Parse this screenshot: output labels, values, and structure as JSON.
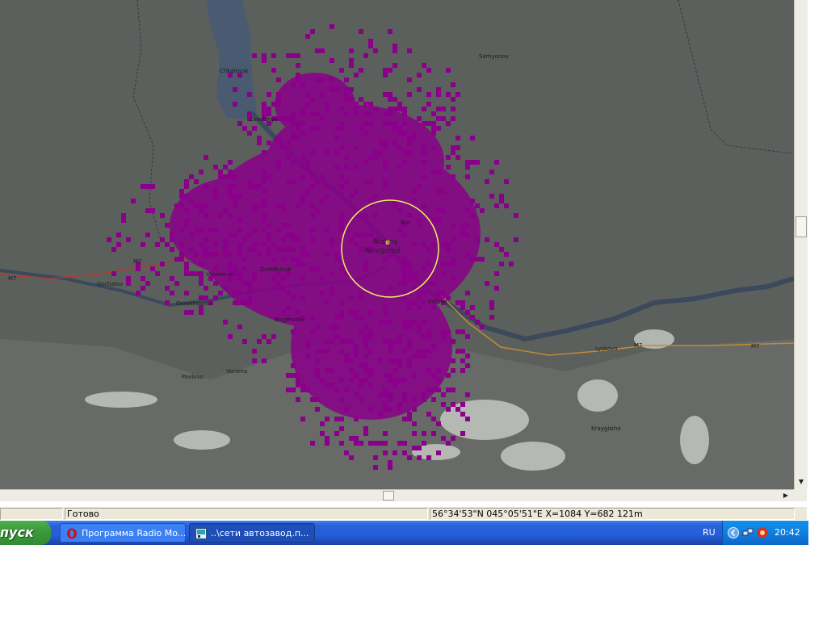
{
  "map": {
    "labels": [
      {
        "text": "Semyonov"
      },
      {
        "text": "Zavolzhye"
      },
      {
        "text": "Chkalovsk"
      },
      {
        "text": "Bor"
      },
      {
        "text": "Nizhny"
      },
      {
        "text": "Novgorod"
      },
      {
        "text": "Dzerzhinsk"
      },
      {
        "text": "Gorbatov"
      },
      {
        "text": "Volodarsk"
      },
      {
        "text": "Bogorodsk"
      },
      {
        "text": "Pavlovo"
      },
      {
        "text": "Vorsma"
      },
      {
        "text": "Lyskovo"
      },
      {
        "text": "Kstovo"
      },
      {
        "text": "Kraygisino"
      },
      {
        "text": "Gorokhovets"
      },
      {
        "text": "M7"
      },
      {
        "text": "M7"
      },
      {
        "text": "M7"
      },
      {
        "text": "M7"
      }
    ],
    "colors": {
      "terrain": "#5c605c",
      "river": "#3a4a5c",
      "coverage": "#8a008a",
      "ring": "#f0f060"
    }
  },
  "scrollbars": {
    "down_arrow": "▼",
    "right_arrow": "▶"
  },
  "statusbar": {
    "ready": "Готово",
    "coords": "56°34'53\"N  045°05'51\"E   X=1084 Y=682 121m"
  },
  "taskbar": {
    "start_label": "пуск",
    "tasks": [
      {
        "label": "Программа Radio Mo...",
        "icon": "opera-icon"
      },
      {
        "label": "..\\сети автозавод.п...",
        "icon": "radio-mobile-icon"
      }
    ],
    "tray": {
      "lang": "RU",
      "clock": "20:42"
    }
  }
}
